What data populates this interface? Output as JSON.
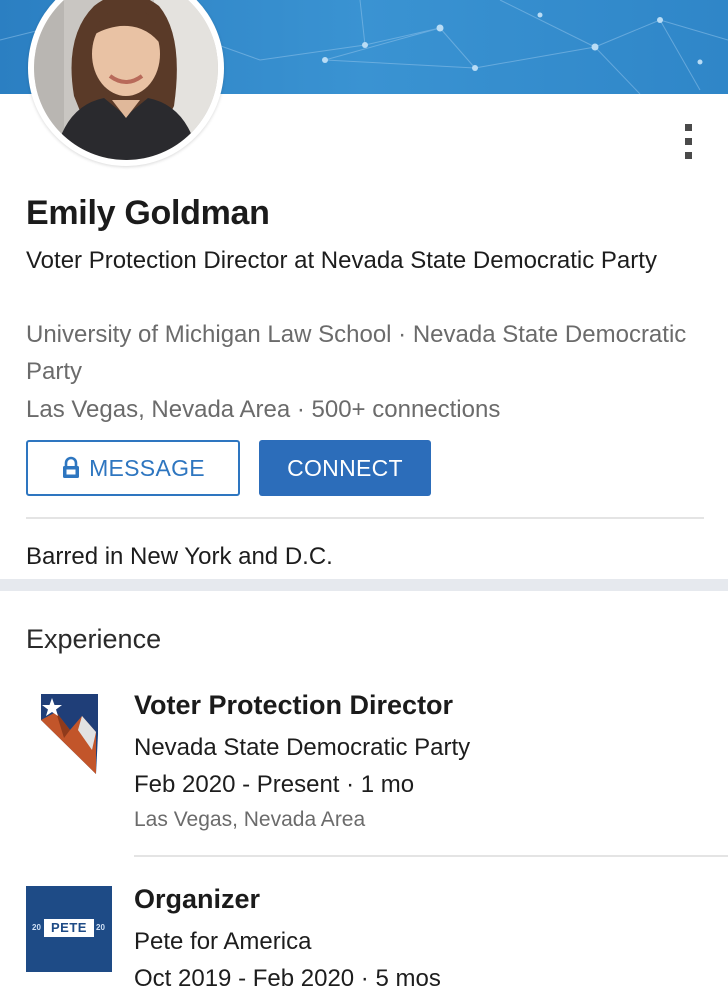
{
  "profile": {
    "name": "Emily Goldman",
    "headline": "Voter Protection Director at Nevada State Democratic Party",
    "education_company": "University of Michigan Law School · Nevada State Democratic Party",
    "location_connections": "Las Vegas, Nevada Area · 500+ connections",
    "summary": "Barred in New York and D.C."
  },
  "actions": {
    "message_label": "MESSAGE",
    "connect_label": "CONNECT"
  },
  "experience": {
    "title": "Experience",
    "items": [
      {
        "role": "Voter Protection Director",
        "company": "Nevada State Democratic Party",
        "dates": "Feb 2020 - Present · 1 mo",
        "location": "Las Vegas, Nevada Area",
        "logo_icon": "nevada-democratic-party-logo"
      },
      {
        "role": "Organizer",
        "company": "Pete for America",
        "dates": "Oct 2019 - Feb 2020 · 5 mos",
        "logo_icon": "pete-2020-logo",
        "logo_text": "PETE",
        "logo_year_left": "20",
        "logo_year_right": "20"
      }
    ]
  },
  "colors": {
    "brand_blue": "#2c6dba",
    "banner_blue": "#3a93d2",
    "secondary_text": "#6b6b6b"
  }
}
